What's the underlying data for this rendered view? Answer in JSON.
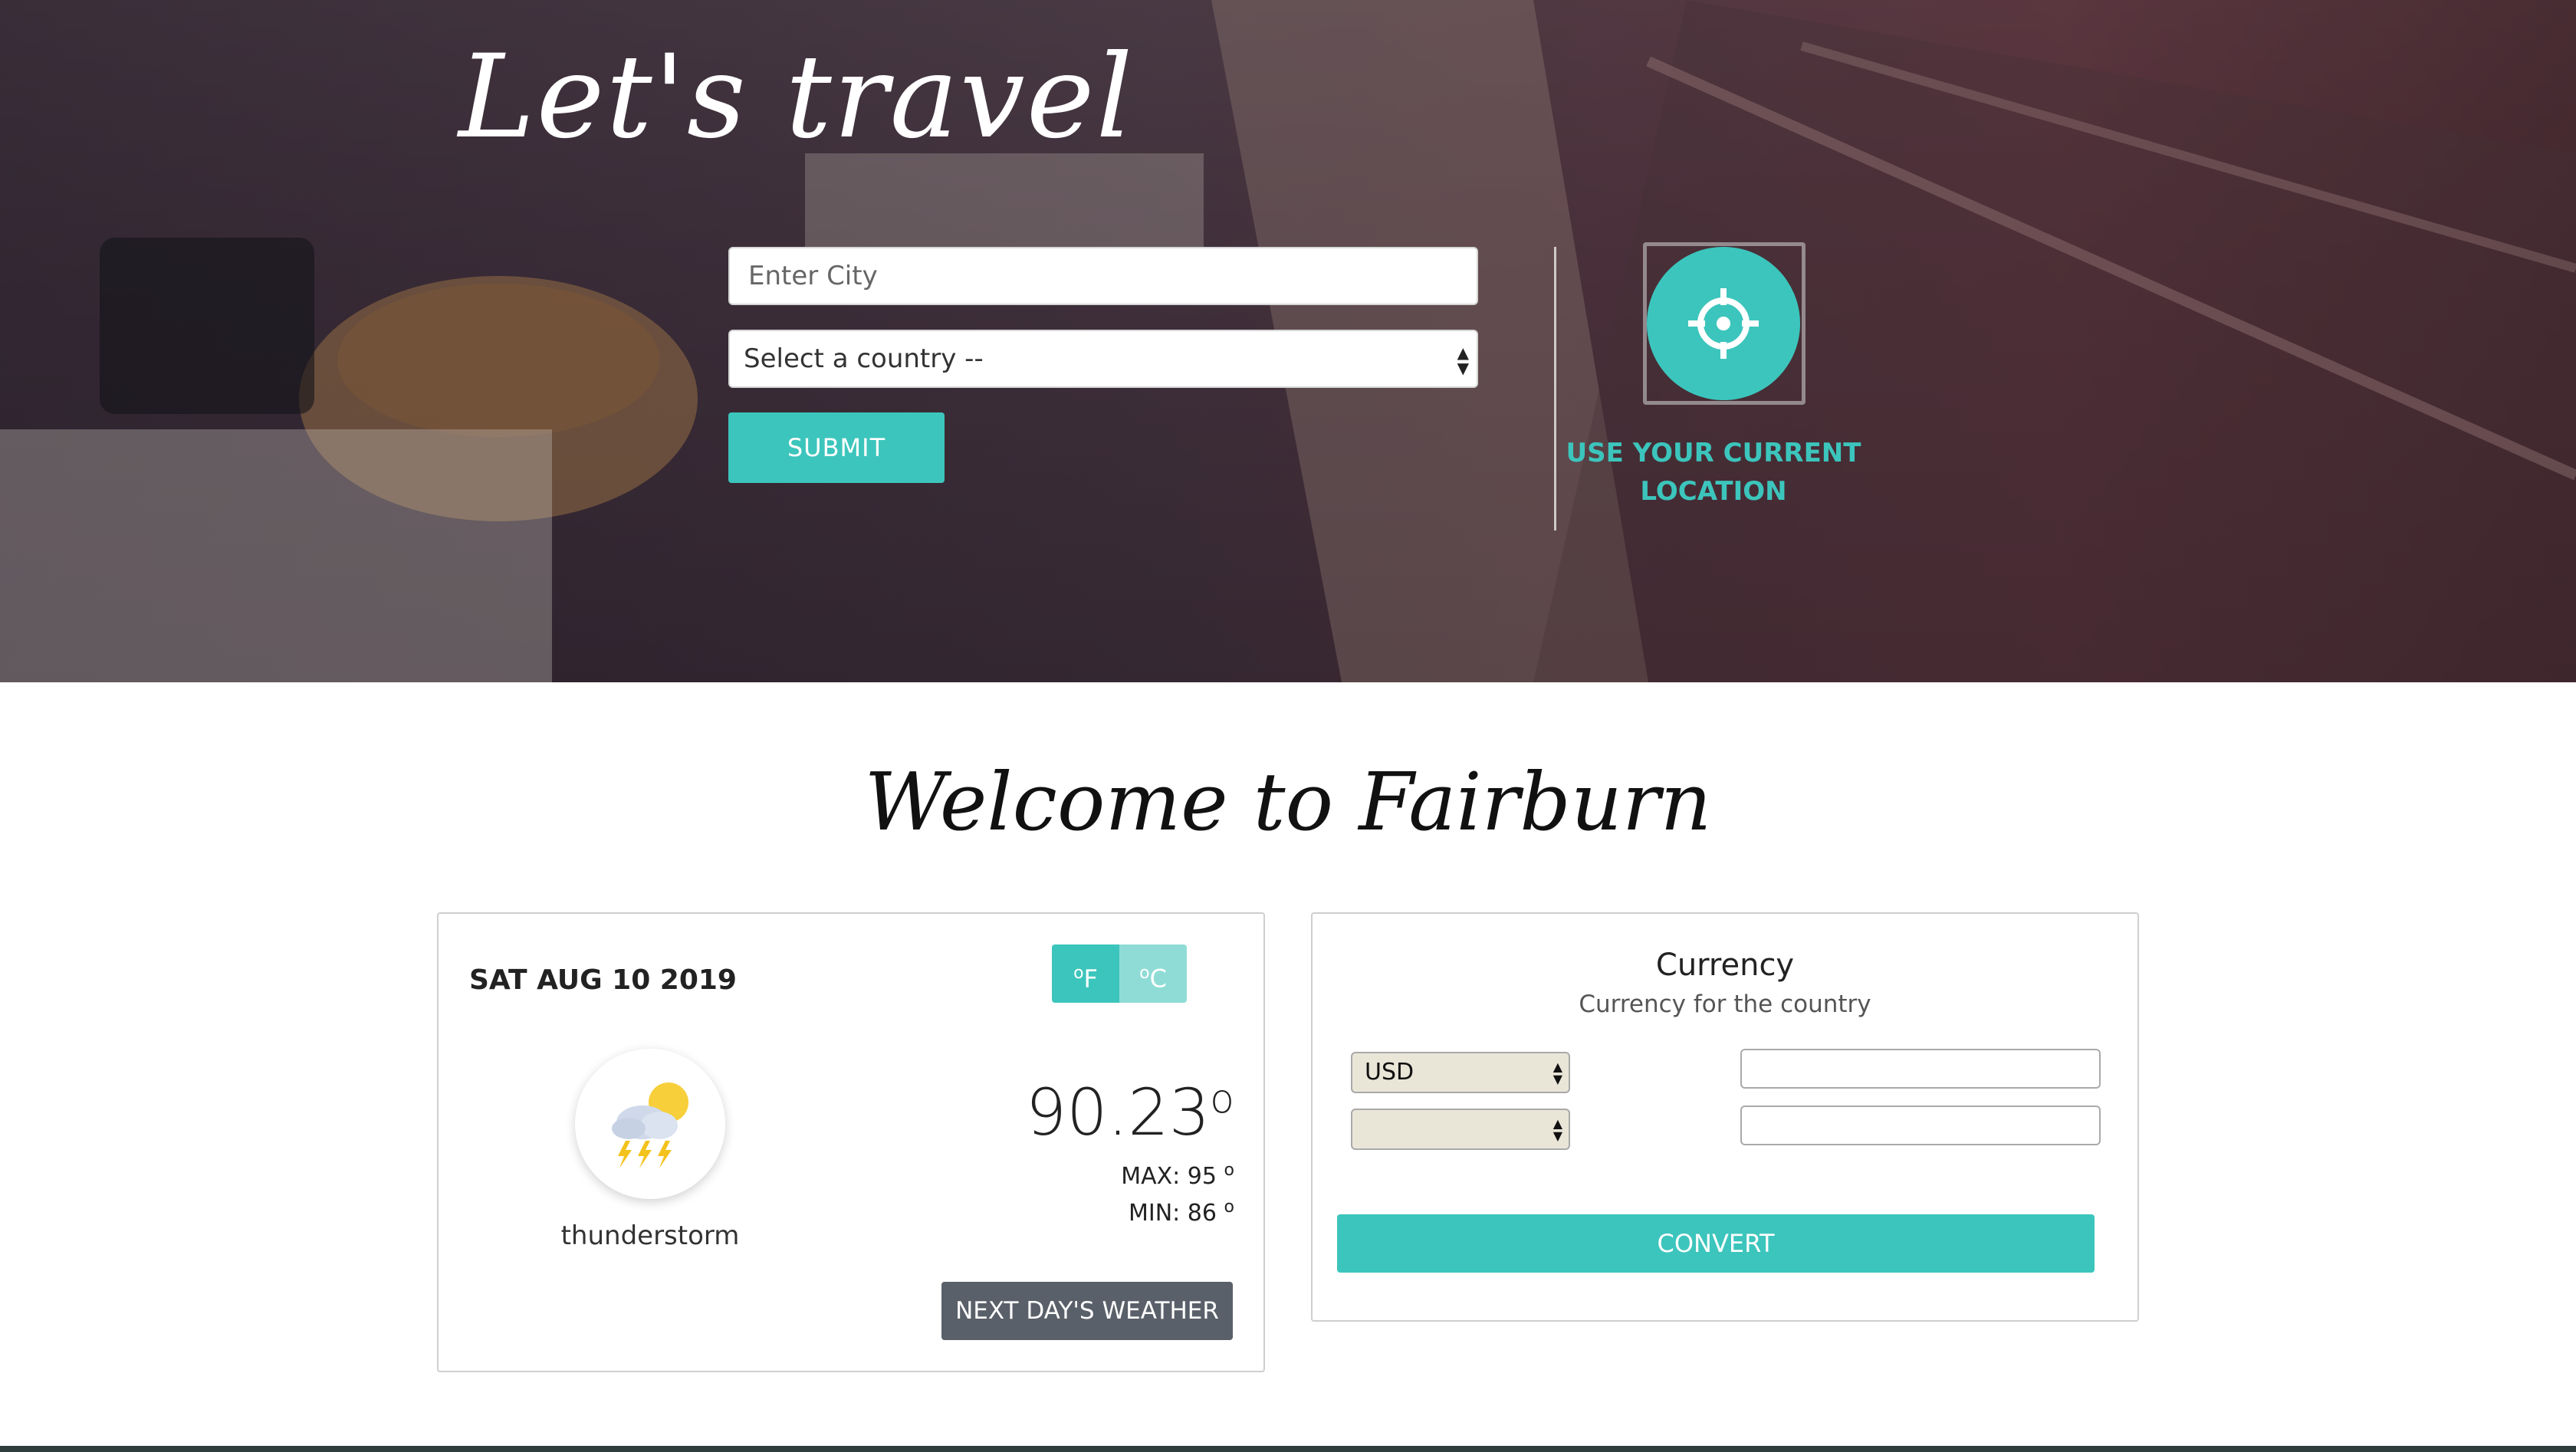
{
  "hero": {
    "title": "Let's travel",
    "city_placeholder": "Enter City",
    "country_selected": "Select a country --",
    "submit_label": "SUBMIT",
    "location_label": "USE YOUR CURRENT LOCATION"
  },
  "welcome": {
    "heading": "Welcome to Fairburn"
  },
  "weather": {
    "date": "SAT AUG 10 2019",
    "unit_f": "F",
    "unit_c": "C",
    "active_unit": "F",
    "icon": "thunderstorm-icon",
    "description": "thunderstorm",
    "temperature": "90.23",
    "max": "MAX: 95",
    "min": "MIN: 86",
    "next_label": "NEXT DAY'S WEATHER"
  },
  "currency": {
    "title": "Currency",
    "subtitle": "Currency for the country",
    "from_selected": "USD",
    "to_selected": "",
    "from_amount": "",
    "to_amount": "",
    "convert_label": "CONVERT"
  },
  "colors": {
    "accent": "#3cc5bc",
    "accent_light": "#8fdcd6",
    "dark_button": "#5a6069"
  }
}
